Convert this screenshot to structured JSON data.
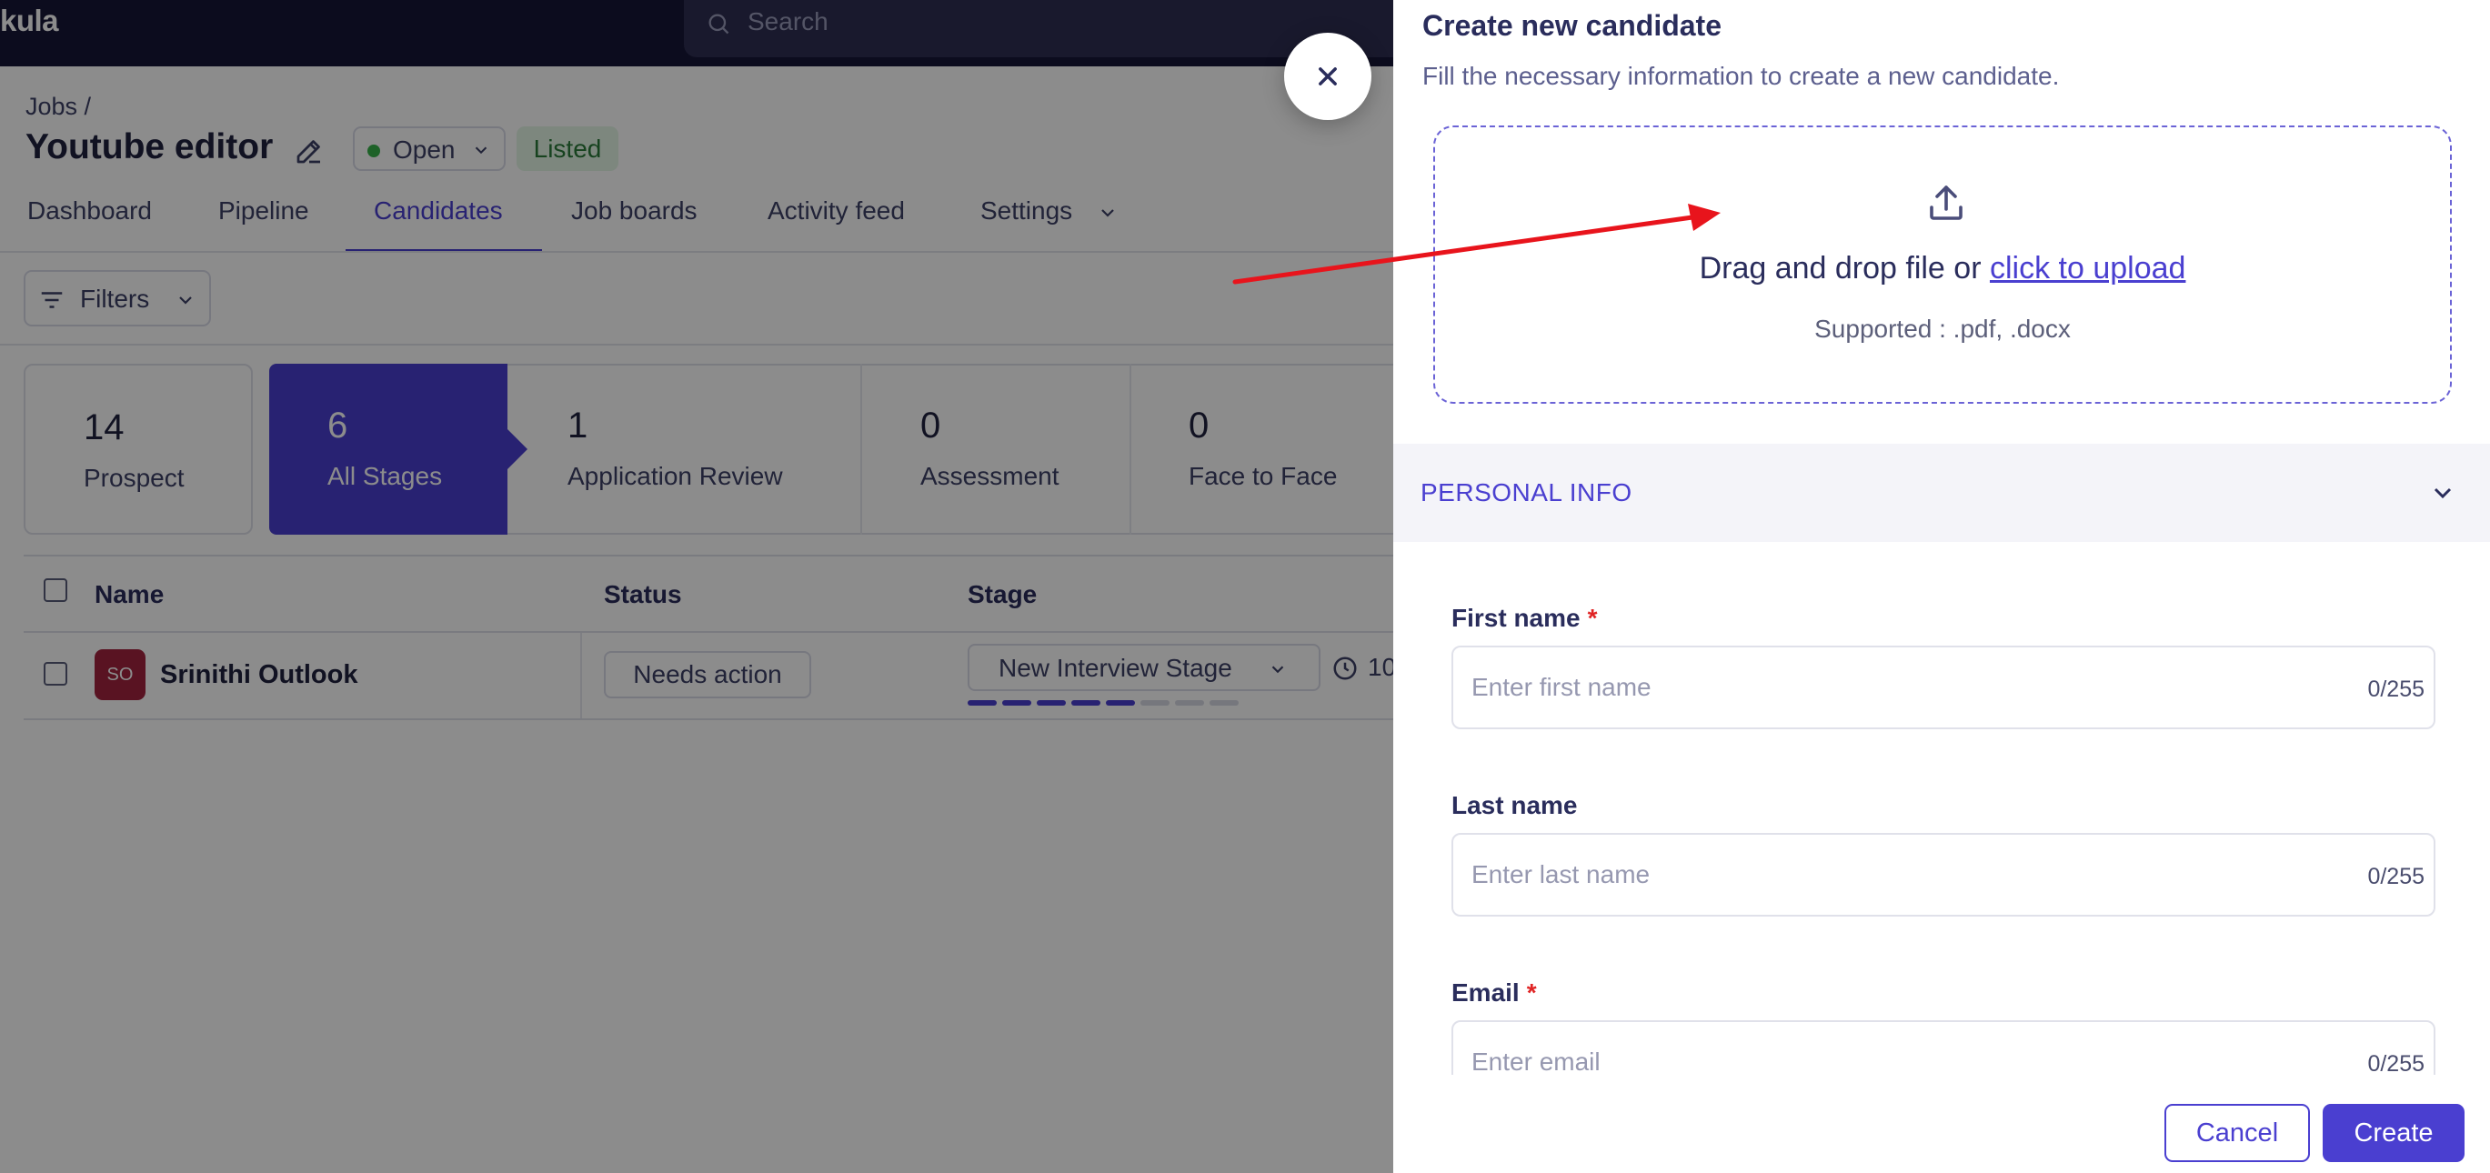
{
  "app": {
    "brand": "kula"
  },
  "search": {
    "placeholder": "Search"
  },
  "header": {
    "breadcrumb": "Jobs /",
    "title": "Youtube editor",
    "status": "Open",
    "listed_badge": "Listed"
  },
  "tabs": [
    "Dashboard",
    "Pipeline",
    "Candidates",
    "Job boards",
    "Activity feed",
    "Settings"
  ],
  "active_tab": "Candidates",
  "toolbar": {
    "filters_label": "Filters"
  },
  "stages": [
    {
      "count": "14",
      "name": "Prospect"
    },
    {
      "count": "6",
      "name": "All Stages"
    },
    {
      "count": "1",
      "name": "Application Review"
    },
    {
      "count": "0",
      "name": "Assessment"
    },
    {
      "count": "0",
      "name": "Face to Face"
    }
  ],
  "table": {
    "headers": [
      "Name",
      "Status",
      "Stage"
    ],
    "rows": [
      {
        "initials": "SO",
        "name": "Srinithi Outlook",
        "status": "Needs action",
        "stage": "New Interview Stage",
        "time": "10",
        "progress_filled": 5,
        "progress_total": 8
      }
    ]
  },
  "panel": {
    "title": "Create new candidate",
    "subtitle": "Fill the necessary information to create a new candidate.",
    "upload_text": "Drag and drop file or ",
    "upload_link": "click to upload",
    "supported": "Supported : .pdf, .docx",
    "section": "PERSONAL INFO",
    "fields": [
      {
        "label": "First name",
        "required": true,
        "placeholder": "Enter first name",
        "counter": "0/255"
      },
      {
        "label": "Last name",
        "required": false,
        "placeholder": "Enter last name",
        "counter": "0/255"
      },
      {
        "label": "Email",
        "required": true,
        "placeholder": "Enter email",
        "counter": "0/255"
      }
    ],
    "required_mark": "*",
    "cancel_label": "Cancel",
    "create_label": "Create"
  },
  "colors": {
    "accent": "#4a3fd0",
    "topbar": "#161638",
    "required": "#e02424",
    "arrow": "#e8141c",
    "open_dot": "#38b24a",
    "avatar": "#a3243f"
  },
  "icons": [
    "search-icon",
    "edit-pencil-icon",
    "chevron-down-icon",
    "filter-icon",
    "clock-icon",
    "close-icon",
    "upload-icon"
  ]
}
